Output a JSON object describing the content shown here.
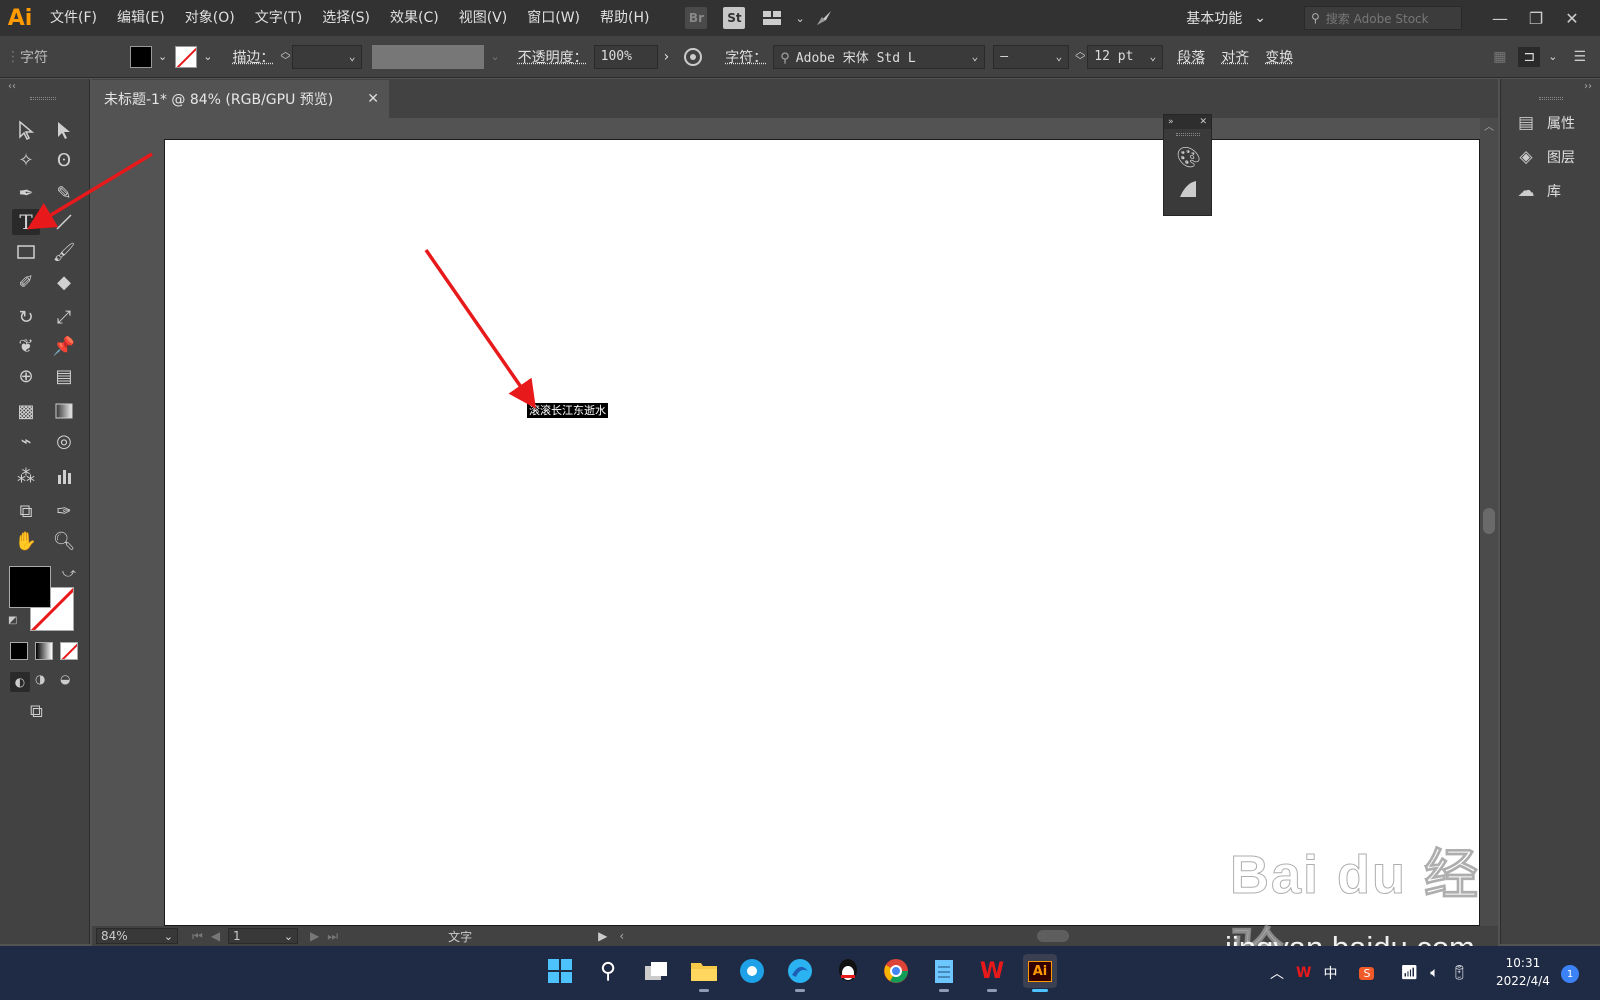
{
  "app": {
    "logo": "Ai",
    "menu": [
      "文件(F)",
      "编辑(E)",
      "对象(O)",
      "文字(T)",
      "选择(S)",
      "效果(C)",
      "视图(V)",
      "窗口(W)",
      "帮助(H)"
    ],
    "bridge_label": "Br",
    "stock_label": "St",
    "workspace": "基本功能",
    "search_placeholder": "搜索 Adobe Stock",
    "window_controls": [
      "—",
      "❐",
      "✕"
    ]
  },
  "control_bar": {
    "mode_label": "字符",
    "stroke_label": "描边：",
    "opacity_label": "不透明度：",
    "opacity_value": "100%",
    "character_label": "字符：",
    "font_name": "Adobe 宋体 Std L",
    "font_style": "–",
    "font_size": "12 pt",
    "paragraph_label": "段落",
    "align_label": "对齐",
    "transform_label": "变换",
    "fill_color": "#000000"
  },
  "document": {
    "tab_title": "未标题-1* @ 84% (RGB/GPU 预览)",
    "selected_text": "滚滚长江东逝水"
  },
  "right_panel": {
    "items": [
      {
        "label": "属性",
        "icon": "properties-icon"
      },
      {
        "label": "图层",
        "icon": "layers-icon"
      },
      {
        "label": "库",
        "icon": "libraries-icon"
      }
    ]
  },
  "status_bar": {
    "zoom": "84%",
    "artboard_number": "1",
    "tool_name": "文字"
  },
  "taskbar": {
    "ime": "中",
    "time": "10:31",
    "date": "2022/4/4",
    "notifications": "1",
    "active_app_label": "Ai"
  },
  "watermark": {
    "logo": "Bai du 经验",
    "url": "jingyan.baidu.com"
  },
  "colors": {
    "accent": "#ff9a00",
    "arrow": "#e8191b"
  }
}
